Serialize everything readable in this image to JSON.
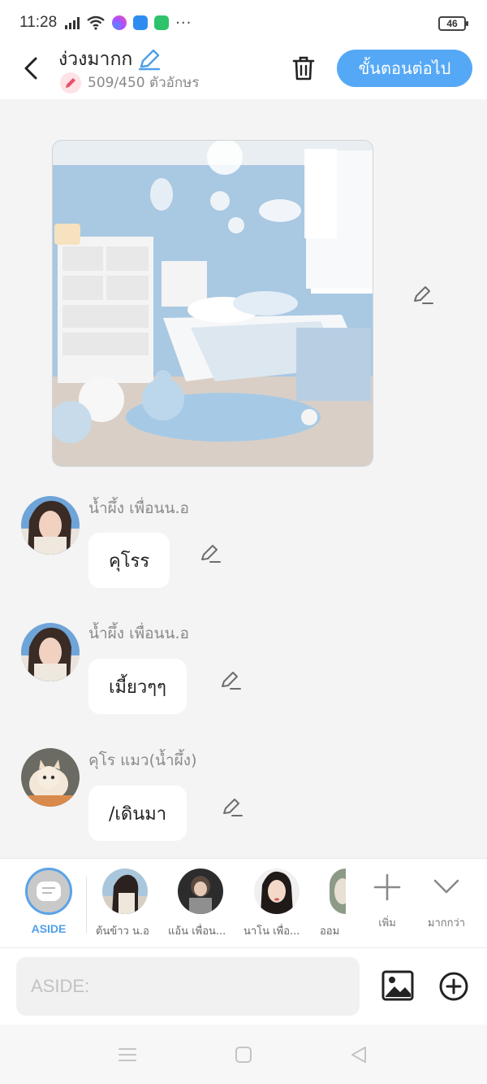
{
  "status_bar": {
    "time": "11:28",
    "more": "···",
    "battery": "46"
  },
  "header": {
    "title": "ง่วงมากก",
    "char_count": "509/450 ตัวอักษร",
    "next_label": "ขั้นตอนต่อไป"
  },
  "messages": [
    {
      "sender": "น้ำผึ้ง เพื่อนน.อ",
      "text": "คุโรร"
    },
    {
      "sender": "น้ำผึ้ง เพื่อนน.อ",
      "text": "เมี้ยวๆๆ"
    },
    {
      "sender": "คุโร แมว(น้ำผึ้ง)",
      "text": "/เดินมา"
    }
  ],
  "characters": {
    "aside_label": "ASIDE",
    "list": [
      {
        "name": "ต้นข้าว น.อ"
      },
      {
        "name": "แอ้น เพื่อน..."
      },
      {
        "name": "นาโน เพื่อ..."
      },
      {
        "name": "ออม"
      }
    ],
    "add_label": "เพิ่ม",
    "more_label": "มากกว่า"
  },
  "input": {
    "placeholder": "ASIDE:"
  },
  "colors": {
    "accent": "#55a8f5",
    "aside_label": "#4f9fe8",
    "badge_pink": "#fde2e6",
    "background": "#f4f4f4"
  }
}
